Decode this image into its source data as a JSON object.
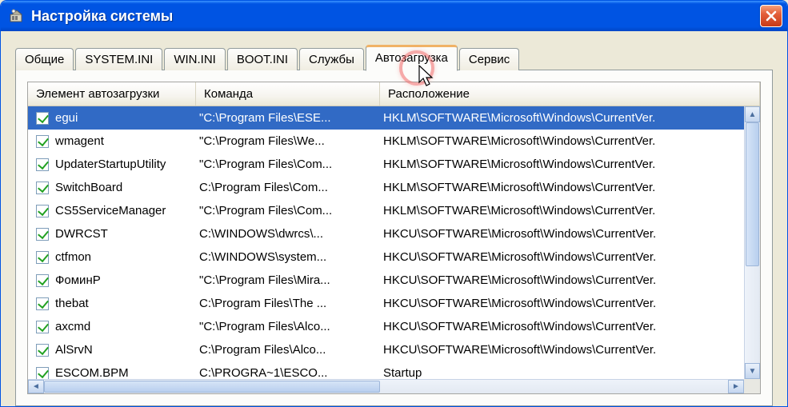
{
  "window": {
    "title": "Настройка системы"
  },
  "tabs": [
    {
      "label": "Общие",
      "active": false
    },
    {
      "label": "SYSTEM.INI",
      "active": false
    },
    {
      "label": "WIN.INI",
      "active": false
    },
    {
      "label": "BOOT.INI",
      "active": false
    },
    {
      "label": "Службы",
      "active": false
    },
    {
      "label": "Автозагрузка",
      "active": true
    },
    {
      "label": "Сервис",
      "active": false
    }
  ],
  "columns": {
    "c1": "Элемент автозагрузки",
    "c2": "Команда",
    "c3": "Расположение"
  },
  "rows": [
    {
      "checked": true,
      "selected": true,
      "name": "egui",
      "cmd": "\"C:\\Program Files\\ESE...",
      "loc": "HKLM\\SOFTWARE\\Microsoft\\Windows\\CurrentVer."
    },
    {
      "checked": true,
      "selected": false,
      "name": "wmagent",
      "cmd": "\"C:\\Program Files\\We...",
      "loc": "HKLM\\SOFTWARE\\Microsoft\\Windows\\CurrentVer."
    },
    {
      "checked": true,
      "selected": false,
      "name": "UpdaterStartupUtility",
      "cmd": "\"C:\\Program Files\\Com...",
      "loc": "HKLM\\SOFTWARE\\Microsoft\\Windows\\CurrentVer."
    },
    {
      "checked": true,
      "selected": false,
      "name": "SwitchBoard",
      "cmd": "C:\\Program Files\\Com...",
      "loc": "HKLM\\SOFTWARE\\Microsoft\\Windows\\CurrentVer."
    },
    {
      "checked": true,
      "selected": false,
      "name": "CS5ServiceManager",
      "cmd": "\"C:\\Program Files\\Com...",
      "loc": "HKLM\\SOFTWARE\\Microsoft\\Windows\\CurrentVer."
    },
    {
      "checked": true,
      "selected": false,
      "name": "DWRCST",
      "cmd": "C:\\WINDOWS\\dwrcs\\...",
      "loc": "HKCU\\SOFTWARE\\Microsoft\\Windows\\CurrentVer."
    },
    {
      "checked": true,
      "selected": false,
      "name": "ctfmon",
      "cmd": "C:\\WINDOWS\\system...",
      "loc": "HKCU\\SOFTWARE\\Microsoft\\Windows\\CurrentVer."
    },
    {
      "checked": true,
      "selected": false,
      "name": "ФоминР",
      "cmd": "\"C:\\Program Files\\Mira...",
      "loc": "HKCU\\SOFTWARE\\Microsoft\\Windows\\CurrentVer."
    },
    {
      "checked": true,
      "selected": false,
      "name": "thebat",
      "cmd": "C:\\Program Files\\The ...",
      "loc": "HKCU\\SOFTWARE\\Microsoft\\Windows\\CurrentVer."
    },
    {
      "checked": true,
      "selected": false,
      "name": "axcmd",
      "cmd": "\"C:\\Program Files\\Alco...",
      "loc": "HKCU\\SOFTWARE\\Microsoft\\Windows\\CurrentVer."
    },
    {
      "checked": true,
      "selected": false,
      "name": "AlSrvN",
      "cmd": "C:\\Program Files\\Alco...",
      "loc": "HKCU\\SOFTWARE\\Microsoft\\Windows\\CurrentVer."
    },
    {
      "checked": true,
      "selected": false,
      "name": "ESCOM.BPM",
      "cmd": "C:\\PROGRA~1\\ESCO...",
      "loc": "Startup"
    }
  ],
  "scroll": {
    "vthumb_top": 0,
    "vthumb_height": 180,
    "hthumb_left": 0,
    "hthumb_width": 420
  }
}
